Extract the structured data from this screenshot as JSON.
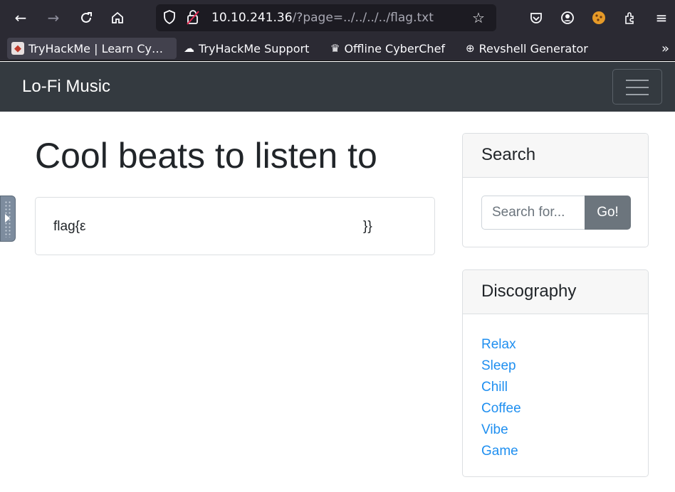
{
  "browser": {
    "url_host": "10.10.241.36",
    "url_rest": "/?page=../../../../flag.txt",
    "bookmarks": [
      {
        "label": "TryHackMe | Learn Cy…",
        "icon": "tryhackme-favicon-icon"
      },
      {
        "label": "TryHackMe Support",
        "icon": "cloud-icon"
      },
      {
        "label": "Offline CyberChef",
        "icon": "chef-hat-icon"
      },
      {
        "label": "Revshell Generator",
        "icon": "globe-icon"
      }
    ],
    "bookmarks_overflow": "»"
  },
  "navbar": {
    "brand": "Lo-Fi Music",
    "background": "#343a40"
  },
  "main": {
    "heading": "Cool beats to listen to",
    "content_text": "flag{ε",
    "content_tail": "}}"
  },
  "search_widget": {
    "title": "Search",
    "placeholder": "Search for...",
    "button_label": "Go!"
  },
  "discography_widget": {
    "title": "Discography",
    "items": [
      "Relax",
      "Sleep",
      "Chill",
      "Coffee",
      "Vibe",
      "Game"
    ],
    "link_color": "#1f8ff0"
  }
}
